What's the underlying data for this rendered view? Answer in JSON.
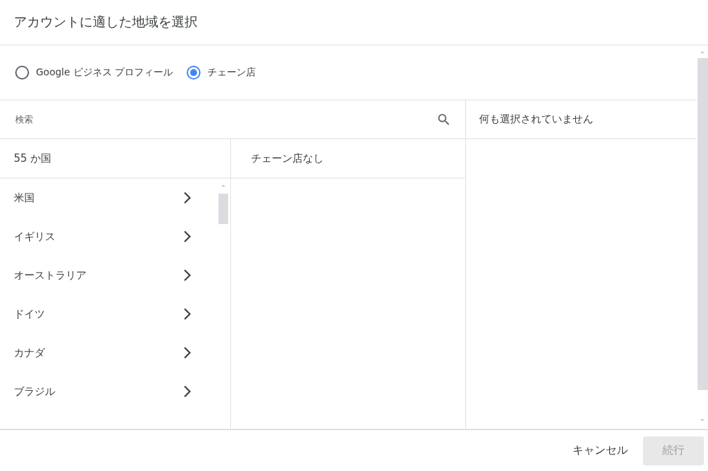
{
  "dialog": {
    "title": "アカウントに適した地域を選択"
  },
  "source_options": [
    {
      "label": "Google ビジネス プロフィール",
      "selected": false
    },
    {
      "label": "チェーン店",
      "selected": true
    }
  ],
  "search": {
    "placeholder": "検索"
  },
  "countries": {
    "header": "55 か国",
    "items": [
      "米国",
      "イギリス",
      "オーストラリア",
      "ドイツ",
      "カナダ",
      "ブラジル"
    ]
  },
  "chains": {
    "header": "チェーン店なし"
  },
  "selection": {
    "header": "何も選択されていません"
  },
  "buttons": [
    {
      "label": "キャンセル",
      "disabled": false
    },
    {
      "label": "続行",
      "disabled": true
    }
  ]
}
